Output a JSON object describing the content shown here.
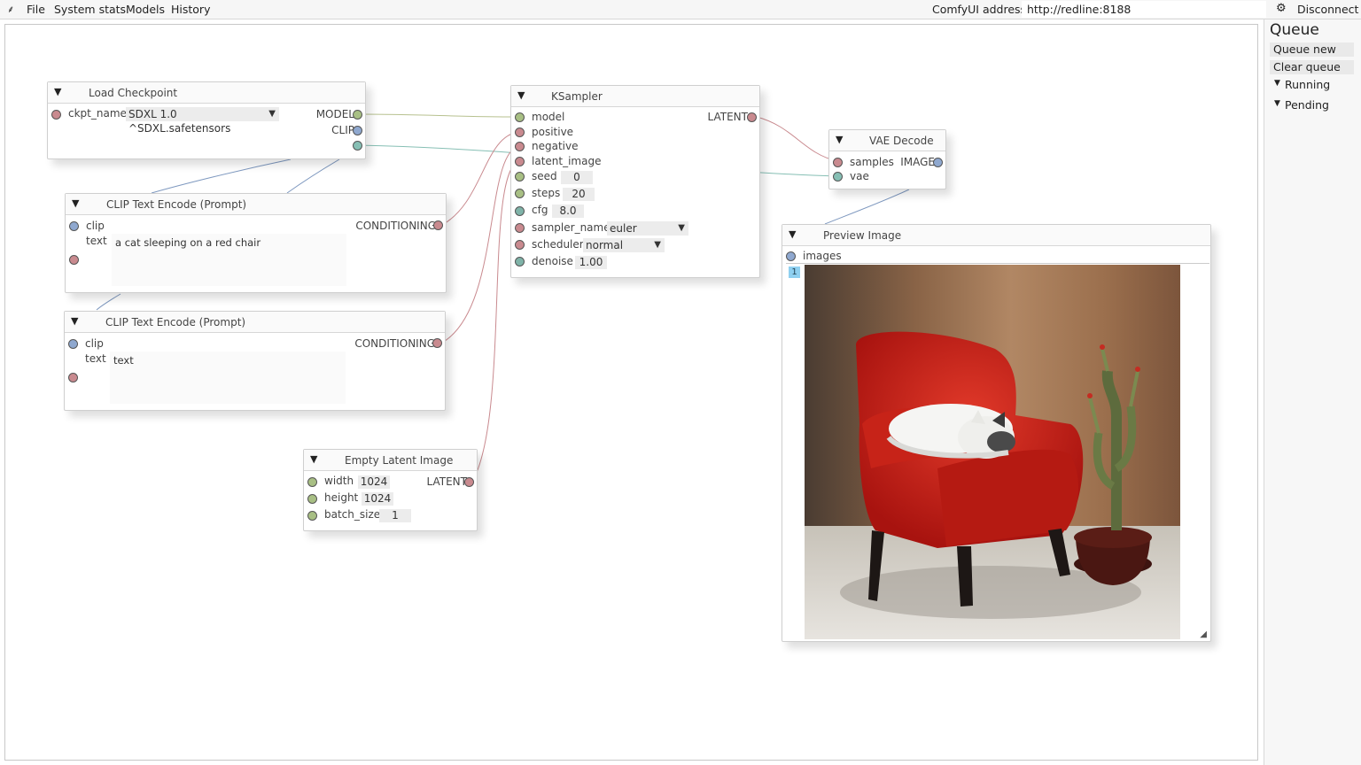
{
  "menubar": {
    "items": [
      "File",
      "System stats",
      "Models",
      "History"
    ],
    "address_label": "ComfyUI address:",
    "address_value": "http://redline:8188",
    "disconnect_label": "Disconnect"
  },
  "nodes": {
    "load_checkpoint": {
      "title": "Load Checkpoint",
      "ckpt_label": "ckpt_name",
      "ckpt_value": "SDXL 1.0 ^SDXL.safetensors",
      "out_model": "MODEL",
      "out_clip": "CLIP"
    },
    "clip1": {
      "title": "CLIP Text Encode (Prompt)",
      "in_clip": "clip",
      "text_label": "text",
      "text_value": "a cat sleeping on a red chair",
      "out": "CONDITIONING"
    },
    "clip2": {
      "title": "CLIP Text Encode (Prompt)",
      "in_clip": "clip",
      "text_label": "text",
      "text_value": "text",
      "out": "CONDITIONING"
    },
    "ksampler": {
      "title": "KSampler",
      "in_model": "model",
      "in_positive": "positive",
      "in_negative": "negative",
      "in_latent": "latent_image",
      "out": "LATENT",
      "seed_label": "seed",
      "seed": "0",
      "steps_label": "steps",
      "steps": "20",
      "cfg_label": "cfg",
      "cfg": "8.0",
      "sampler_label": "sampler_name",
      "sampler": "euler",
      "scheduler_label": "scheduler",
      "scheduler": "normal",
      "denoise_label": "denoise",
      "denoise": "1.00"
    },
    "vae_decode": {
      "title": "VAE Decode",
      "in_samples": "samples",
      "in_vae": "vae",
      "out": "IMAGE"
    },
    "empty_latent": {
      "title": "Empty Latent Image",
      "width_label": "width",
      "width": "1024",
      "height_label": "height",
      "height": "1024",
      "batch_label": "batch_size",
      "batch": "1",
      "out": "LATENT"
    },
    "preview": {
      "title": "Preview Image",
      "in_images": "images",
      "badge": "1",
      "image_subject": "painting of a white cat sleeping on a red armchair beside a potted cactus"
    }
  },
  "queue": {
    "title": "Queue",
    "queue_new": "Queue new",
    "clear_queue": "Clear queue",
    "running": "Running",
    "pending": "Pending"
  },
  "icons": {
    "app": "comfy-logo-icon",
    "settings": "gear-icon",
    "collapse": "triangle-down-icon",
    "dropdown": "chevron-down-icon"
  },
  "colors": {
    "model_wire": "#b7c18f",
    "conditioning_wire": "#c98a8f",
    "clip_wire": "#7e98bf",
    "vae_wire": "#86bfb4",
    "image_red": "#d0201c"
  }
}
